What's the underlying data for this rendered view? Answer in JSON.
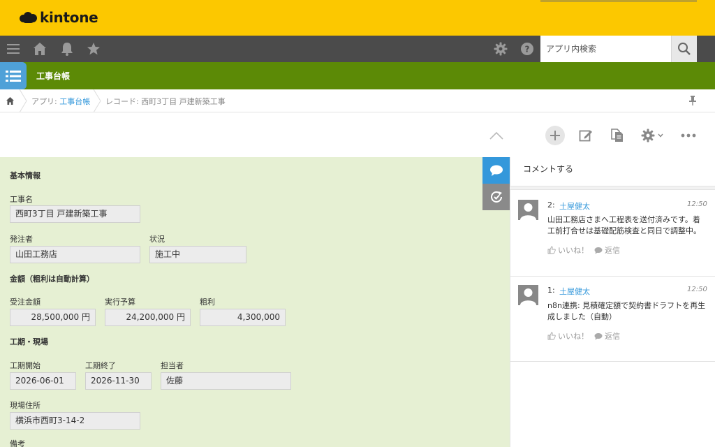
{
  "header": {
    "logo_text": "kintone"
  },
  "nav": {
    "search_placeholder": "アプリ内検索"
  },
  "app": {
    "title": "工事台帳"
  },
  "breadcrumb": {
    "app_prefix": "アプリ: ",
    "app_link": "工事台帳",
    "record_prefix": "レコード: ",
    "record_name": "西町3丁目 戸建新築工事"
  },
  "form": {
    "section_basic": "基本情報",
    "section_amount": "金額（粗利は自動計算）",
    "section_period": "工期・現場",
    "fields": {
      "project_name": {
        "label": "工事名",
        "value": "西町3丁目 戸建新築工事"
      },
      "client": {
        "label": "発注者",
        "value": "山田工務店"
      },
      "status": {
        "label": "状況",
        "value": "施工中"
      },
      "order_amount": {
        "label": "受注金額",
        "value": "28,500,000 円"
      },
      "exec_budget": {
        "label": "実行予算",
        "value": "24,200,000 円"
      },
      "gross_profit": {
        "label": "粗利",
        "value": "4,300,000"
      },
      "start_date": {
        "label": "工期開始",
        "value": "2026-06-01"
      },
      "end_date": {
        "label": "工期終了",
        "value": "2026-11-30"
      },
      "person": {
        "label": "担当者",
        "value": "佐藤"
      },
      "address": {
        "label": "現場住所",
        "value": "横浜市西町3-14-2"
      },
      "notes": {
        "label": "備考"
      }
    }
  },
  "comments": {
    "input_placeholder": "コメントする",
    "items": [
      {
        "num": "2:",
        "author": "土屋健太",
        "time": "12:50",
        "body": "山田工務店さまへ工程表を送付済みです。着工前打合せは基礎配筋検査と同日で調整中。",
        "like": "いいね！",
        "reply": "返信"
      },
      {
        "num": "1:",
        "author": "土屋健太",
        "time": "12:50",
        "body": "n8n連携: 見積確定額で契約書ドラフトを再生成しました（自動）",
        "like": "いいね！",
        "reply": "返信"
      }
    ]
  },
  "colors": {
    "header": "#fcc800",
    "navbar": "#4b4b4b",
    "appbar": "#5c8a06",
    "form_bg": "#e6f0d3",
    "link": "#3498db"
  }
}
